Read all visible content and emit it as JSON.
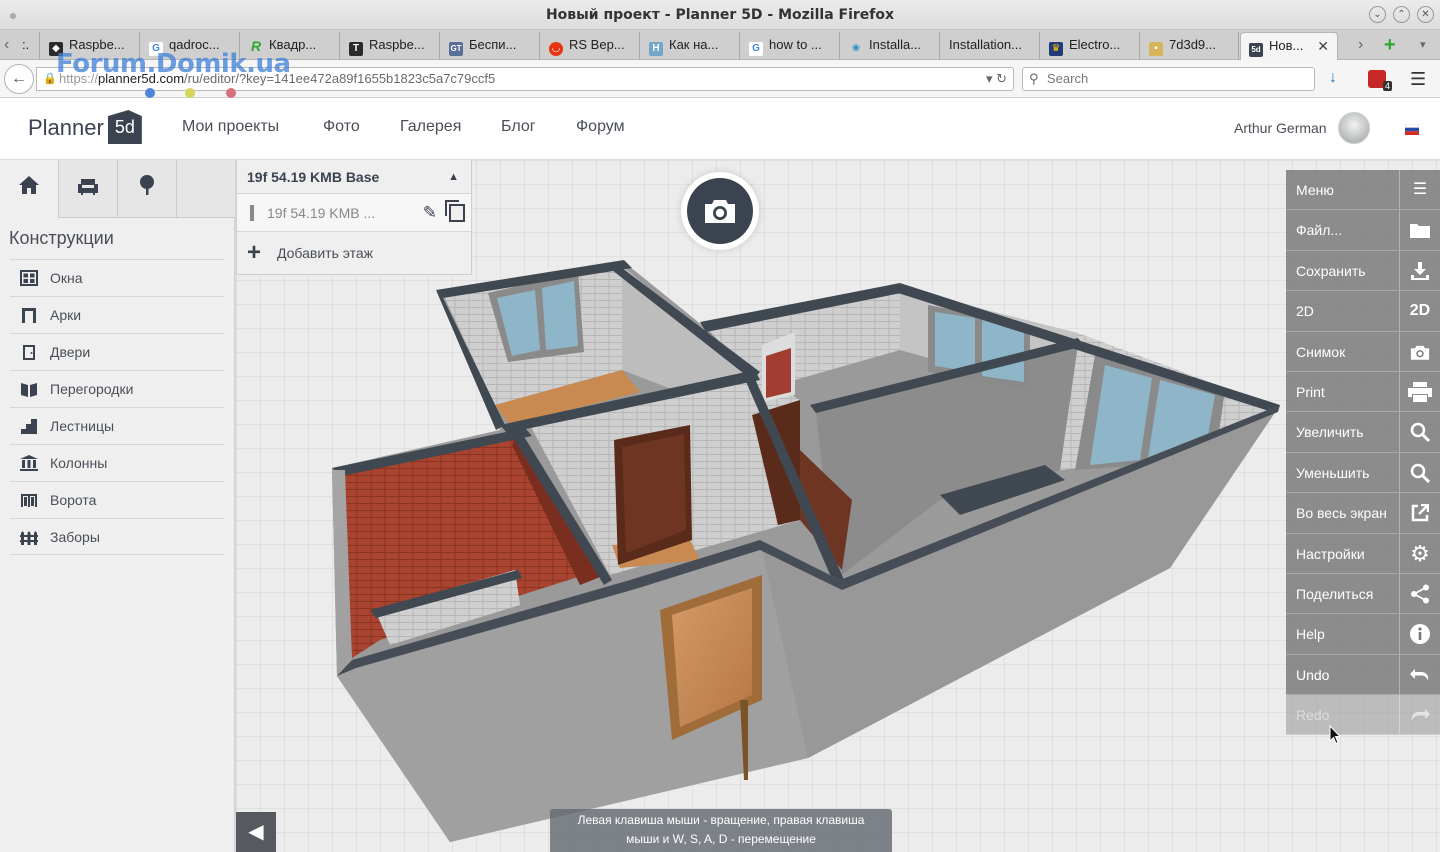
{
  "window": {
    "title": "Новый проект - Planner 5D - Mozilla Firefox"
  },
  "tabs": [
    {
      "label": "Raspbe...",
      "icon": "raspberry-icon",
      "color": "#c7053d"
    },
    {
      "label": "qadroc...",
      "icon": "google-icon",
      "color": "#4285f4"
    },
    {
      "label": "Квадр...",
      "icon": "r-icon",
      "color": "#2eaa2e"
    },
    {
      "label": "Raspbe...",
      "icon": "t-icon",
      "color": "#2b2b2b"
    },
    {
      "label": "Беспи...",
      "icon": "gt-icon",
      "color": "#5a6e9a"
    },
    {
      "label": "RS Вер...",
      "icon": "rs-icon",
      "color": "#e63312"
    },
    {
      "label": "Как на...",
      "icon": "h-icon",
      "color": "#74a6c9"
    },
    {
      "label": "how to ...",
      "icon": "google-icon",
      "color": "#4285f4"
    },
    {
      "label": "Installa...",
      "icon": "raspberry-icon",
      "color": "#1c8ac9"
    },
    {
      "label": "Installation...",
      "icon": "",
      "color": ""
    },
    {
      "label": "Electro...",
      "icon": "crown-icon",
      "color": "#223a7a"
    },
    {
      "label": "7d3d9...",
      "icon": "image-icon",
      "color": "#d7b45c"
    },
    {
      "label": "Нов...",
      "icon": "planner5d-icon",
      "color": "#3b4350",
      "active": true
    }
  ],
  "nav": {
    "url_prefix": "https://",
    "url_host": "planner5d.com",
    "url_path": "/ru/editor/?key=141ee472a89f1655b1823c5a7c79ccf5",
    "search_placeholder": "Search",
    "badge_count": "4"
  },
  "watermark": "Forum.Domik.ua",
  "header": {
    "logo_text": "Planner",
    "logo_mark": "5d",
    "nav": [
      "Мои проекты",
      "Фото",
      "Галерея",
      "Блог",
      "Форум"
    ],
    "user": "Arthur German"
  },
  "left": {
    "heading": "Конструкции",
    "items": [
      {
        "label": "Окна",
        "icon": "window-icon"
      },
      {
        "label": "Арки",
        "icon": "arch-icon"
      },
      {
        "label": "Двери",
        "icon": "door-icon"
      },
      {
        "label": "Перегородки",
        "icon": "partition-icon"
      },
      {
        "label": "Лестницы",
        "icon": "stairs-icon"
      },
      {
        "label": "Колонны",
        "icon": "columns-icon"
      },
      {
        "label": "Ворота",
        "icon": "gate-icon"
      },
      {
        "label": "Заборы",
        "icon": "fence-icon"
      }
    ]
  },
  "floor": {
    "header": "19f 54.19 KMB Base",
    "current": "19f 54.19 KMB ...",
    "add": "Добавить этаж"
  },
  "menu": [
    {
      "label": "Меню",
      "icon": "hamburger-icon"
    },
    {
      "label": "Файл...",
      "icon": "folder-icon"
    },
    {
      "label": "Сохранить",
      "icon": "download-icon"
    },
    {
      "label": "2D",
      "icon": "2d-icon",
      "icon_text": "2D"
    },
    {
      "label": "Снимок",
      "icon": "camera-icon"
    },
    {
      "label": "Print",
      "icon": "print-icon"
    },
    {
      "label": "Увеличить",
      "icon": "zoom-in-icon"
    },
    {
      "label": "Уменьшить",
      "icon": "zoom-out-icon"
    },
    {
      "label": "Во весь экран",
      "icon": "fullscreen-icon"
    },
    {
      "label": "Настройки",
      "icon": "gear-icon"
    },
    {
      "label": "Поделиться",
      "icon": "share-icon"
    },
    {
      "label": "Help",
      "icon": "info-icon"
    },
    {
      "label": "Undo",
      "icon": "undo-icon"
    },
    {
      "label": "Redo",
      "icon": "redo-icon",
      "disabled": true
    }
  ],
  "hint": {
    "line1": "Левая клавиша мыши - вращение, правая клавиша",
    "line2": "мыши и W, S, A, D - перемещение"
  }
}
